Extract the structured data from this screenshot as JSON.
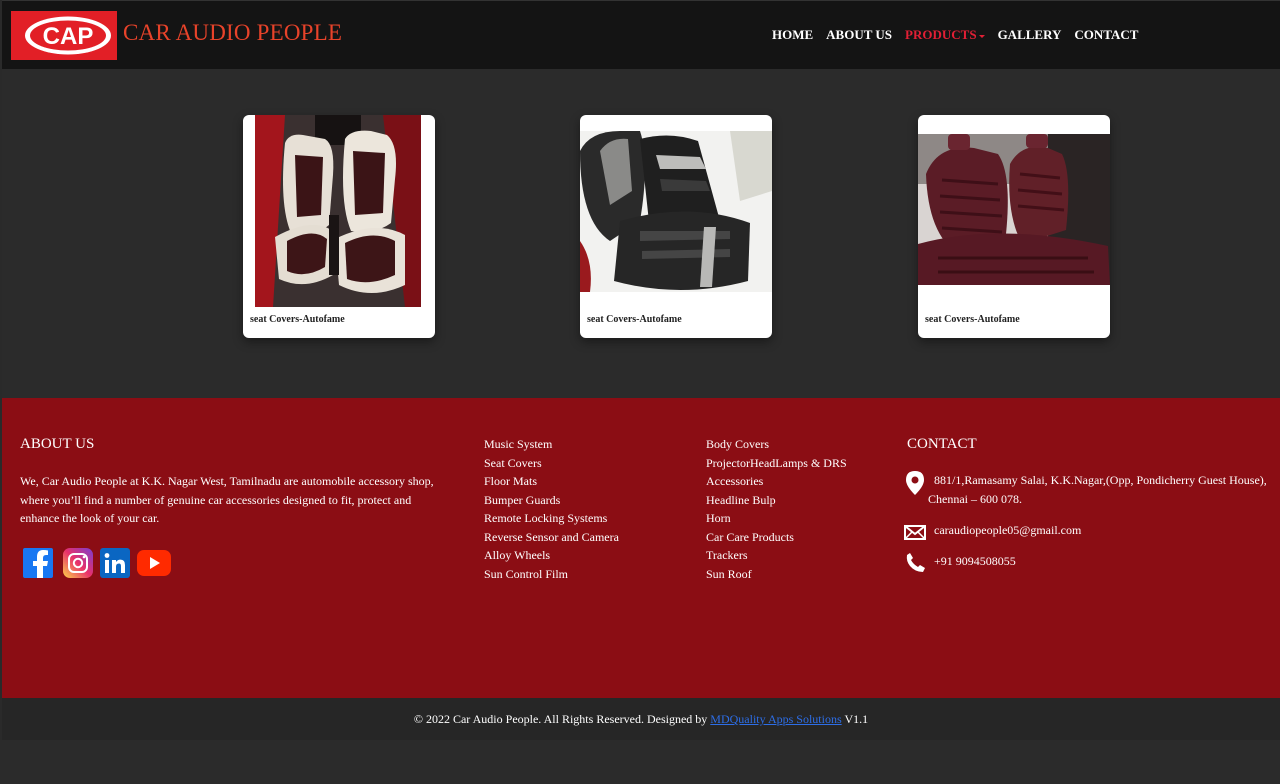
{
  "header": {
    "logo_text": "CAP",
    "brand": "CAR AUDIO PEOPLE",
    "nav": [
      {
        "label": "HOME"
      },
      {
        "label": "ABOUT US"
      },
      {
        "label": "PRODUCTS"
      },
      {
        "label": "GALLERY"
      },
      {
        "label": "CONTACT"
      }
    ]
  },
  "products": [
    {
      "caption": "seat Covers-Autofame",
      "image": "white-seat-covers-photo"
    },
    {
      "caption": "seat Covers-Autofame",
      "image": "black-seat-covers-photo"
    },
    {
      "caption": "seat Covers-Autofame",
      "image": "maroon-seat-covers-photo"
    }
  ],
  "footer": {
    "about_title": "ABOUT US",
    "about_text": "We, Car Audio People at K.K. Nagar West, Tamilnadu are automobile accessory shop, where you’ll find a number of genuine car accessories designed to fit, protect and enhance the look of your car.",
    "links_col1": [
      "Music System",
      "Seat Covers",
      "Floor Mats",
      "Bumper Guards",
      "Remote Locking Systems",
      "Reverse Sensor and Camera",
      "Alloy Wheels",
      "Sun Control Film"
    ],
    "links_col2": [
      "Body Covers",
      "ProjectorHeadLamps & DRS",
      "Accessories",
      "Headline Bulp",
      "Horn",
      "Car Care Products",
      "Trackers",
      "Sun Roof"
    ],
    "contact_title": "CONTACT",
    "address_line1": "881/1,Ramasamy Salai, K.K.Nagar,(Opp, Pondicherry Guest House),",
    "address_line2": "Chennai – 600 078.",
    "email": "caraudiopeople05@gmail.com",
    "phone": "+91 9094508055"
  },
  "bottom": {
    "copyright": "© 2022 Car Audio People. All Rights Reserved. Designed by",
    "designer": "MDQuality Apps Solutions",
    "version": "V1.1"
  },
  "colors": {
    "accent_red": "#e21f26",
    "footer_red": "#8b0d14",
    "link_blue": "#2d6ee8"
  }
}
